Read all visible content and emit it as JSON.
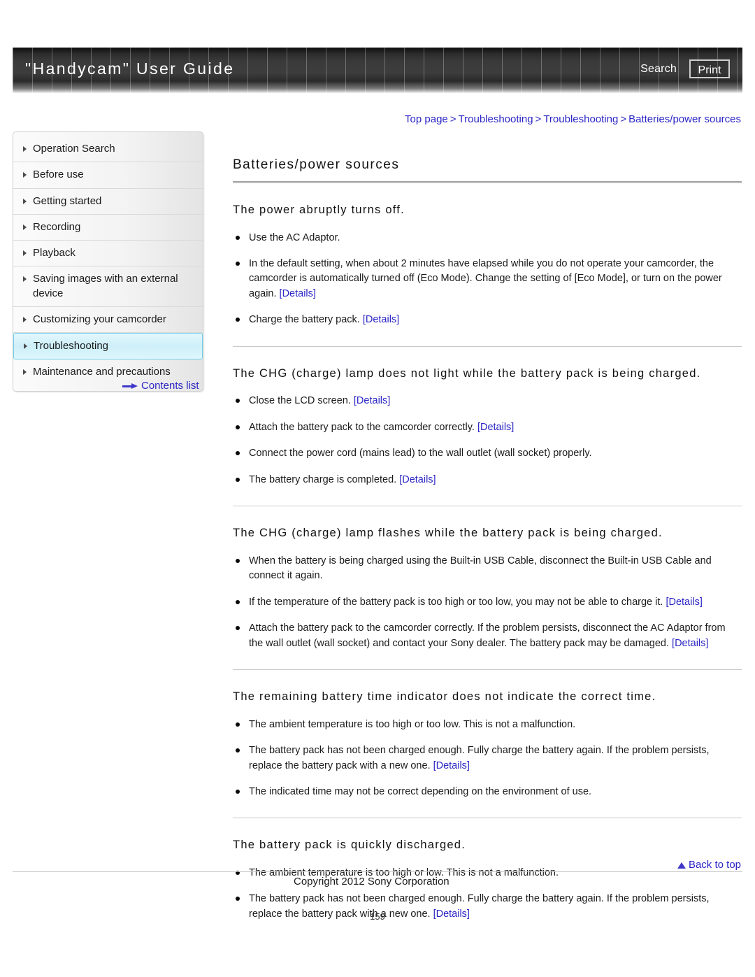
{
  "header": {
    "title": "\"Handycam\" User Guide",
    "search_label": "Search",
    "print_label": "Print"
  },
  "breadcrumb": {
    "items": [
      "Top page",
      "Troubleshooting",
      "Troubleshooting",
      "Batteries/power sources"
    ],
    "separator": ">"
  },
  "sidebar": {
    "items": [
      {
        "label": "Operation Search",
        "active": false
      },
      {
        "label": "Before use",
        "active": false
      },
      {
        "label": "Getting started",
        "active": false
      },
      {
        "label": "Recording",
        "active": false
      },
      {
        "label": "Playback",
        "active": false
      },
      {
        "label": "Saving images with an external device",
        "active": false
      },
      {
        "label": "Customizing your camcorder",
        "active": false
      },
      {
        "label": "Troubleshooting",
        "active": true
      },
      {
        "label": "Maintenance and precautions",
        "active": false
      }
    ],
    "contents_list_label": "Contents list"
  },
  "main": {
    "page_title": "Batteries/power sources",
    "sections": [
      {
        "heading": "The power abruptly turns off.",
        "bullets": [
          {
            "parts": [
              {
                "t": "Use the AC Adaptor.",
                "link": false
              }
            ]
          },
          {
            "parts": [
              {
                "t": "In the default setting, when about 2 minutes have elapsed while you do not operate your camcorder, the camcorder is automatically turned off (Eco Mode). Change the setting of [Eco Mode], or turn on the power again. ",
                "link": false
              },
              {
                "t": "[Details]",
                "link": true
              }
            ]
          },
          {
            "parts": [
              {
                "t": "Charge the battery pack. ",
                "link": false
              },
              {
                "t": "[Details]",
                "link": true
              }
            ]
          }
        ]
      },
      {
        "heading": "The CHG (charge) lamp does not light while the battery pack is being charged.",
        "bullets": [
          {
            "parts": [
              {
                "t": "Close the LCD screen. ",
                "link": false
              },
              {
                "t": "[Details]",
                "link": true
              }
            ]
          },
          {
            "parts": [
              {
                "t": "Attach the battery pack to the camcorder correctly. ",
                "link": false
              },
              {
                "t": "[Details]",
                "link": true
              }
            ]
          },
          {
            "parts": [
              {
                "t": "Connect the power cord (mains lead) to the wall outlet (wall socket) properly.",
                "link": false
              }
            ]
          },
          {
            "parts": [
              {
                "t": "The battery charge is completed. ",
                "link": false
              },
              {
                "t": "[Details]",
                "link": true
              }
            ]
          }
        ]
      },
      {
        "heading": "The CHG (charge) lamp flashes while the battery pack is being charged.",
        "bullets": [
          {
            "parts": [
              {
                "t": "When the battery is being charged using the Built-in USB Cable, disconnect the Built-in USB Cable and connect it again.",
                "link": false
              }
            ]
          },
          {
            "parts": [
              {
                "t": "If the temperature of the battery pack is too high or too low, you may not be able to charge it. ",
                "link": false
              },
              {
                "t": "[Details]",
                "link": true
              }
            ]
          },
          {
            "parts": [
              {
                "t": "Attach the battery pack to the camcorder correctly. If the problem persists, disconnect the AC Adaptor from the wall outlet (wall socket) and contact your Sony dealer. The battery pack may be damaged. ",
                "link": false
              },
              {
                "t": "[Details]",
                "link": true
              }
            ]
          }
        ]
      },
      {
        "heading": "The remaining battery time indicator does not indicate the correct time.",
        "bullets": [
          {
            "parts": [
              {
                "t": "The ambient temperature is too high or too low. This is not a malfunction.",
                "link": false
              }
            ]
          },
          {
            "parts": [
              {
                "t": "The battery pack has not been charged enough. Fully charge the battery again. If the problem persists, replace the battery pack with a new one. ",
                "link": false
              },
              {
                "t": "[Details]",
                "link": true
              }
            ]
          },
          {
            "parts": [
              {
                "t": "The indicated time may not be correct depending on the environment of use.",
                "link": false
              }
            ]
          }
        ]
      },
      {
        "heading": "The battery pack is quickly discharged.",
        "bullets": [
          {
            "parts": [
              {
                "t": "The ambient temperature is too high or low. This is not a malfunction.",
                "link": false
              }
            ]
          },
          {
            "parts": [
              {
                "t": "The battery pack has not been charged enough. Fully charge the battery again. If the problem persists, replace the battery pack with a new one. ",
                "link": false
              },
              {
                "t": "[Details]",
                "link": true
              }
            ]
          }
        ]
      }
    ]
  },
  "footer": {
    "back_to_top_label": "Back to top",
    "copyright": "Copyright 2012 Sony Corporation",
    "page_number": "159"
  },
  "colors": {
    "link": "#2b25c4",
    "active_nav_bg": "#cdeff9",
    "active_nav_border": "#6fd0ea",
    "banner_dark": "#3a3a3a"
  }
}
